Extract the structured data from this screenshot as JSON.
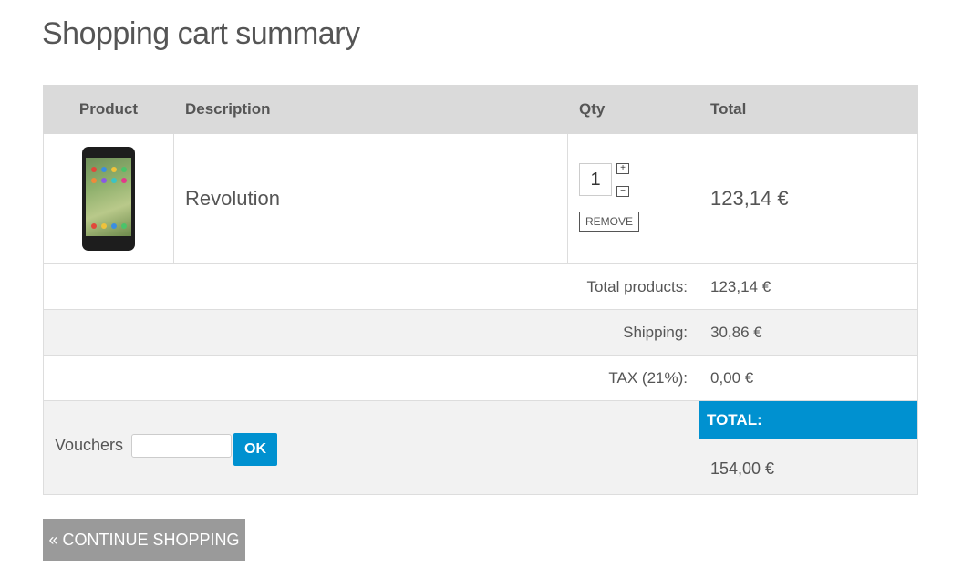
{
  "page": {
    "title": "Shopping cart summary"
  },
  "table": {
    "headers": {
      "product": "Product",
      "description": "Description",
      "qty": "Qty",
      "total": "Total"
    },
    "item": {
      "image_icon": "phone-image",
      "description": "Revolution",
      "qty": "1",
      "increase": "+",
      "decrease": "−",
      "remove_label": "REMOVE",
      "total": "123,14 €"
    }
  },
  "summary": {
    "total_products_label": "Total products:",
    "total_products_value": "123,14 €",
    "shipping_label": "Shipping:",
    "shipping_value": "30,86 €",
    "tax_label": "TAX (21%):",
    "tax_value": "0,00 €",
    "total_label": "TOTAL:",
    "total_value": "154,00 €"
  },
  "voucher": {
    "label": "Vouchers",
    "value": "",
    "ok_label": "OK"
  },
  "continue_label": "« CONTINUE SHOPPING",
  "colors": {
    "accent": "#0091d0",
    "header_bg": "#dadada",
    "button_gray": "#9a9a9a"
  }
}
